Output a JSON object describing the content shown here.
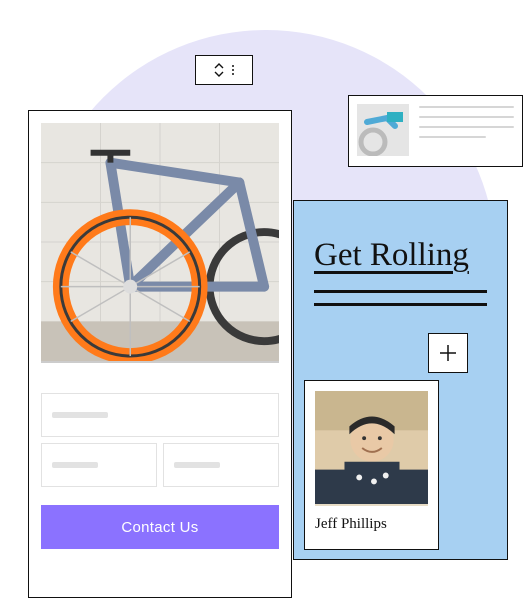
{
  "handle": {
    "icon": "drag-handle"
  },
  "mini_card": {
    "thumb": "shoe-and-pedal"
  },
  "blue_panel": {
    "title": "Get Rolling",
    "plus_icon": "plus"
  },
  "profile": {
    "name": "Jeff Phillips",
    "photo": "person-smiling"
  },
  "phone": {
    "hero": "bicycle-orange-wheel",
    "cta_label": "Contact Us"
  }
}
